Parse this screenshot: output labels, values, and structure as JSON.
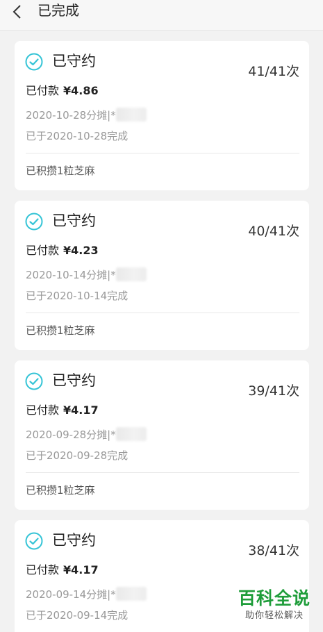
{
  "header": {
    "title": "已完成",
    "back_icon": "chevron-left-icon"
  },
  "colors": {
    "check_accent": "#35c4d6",
    "background": "#f2f2f2"
  },
  "records": [
    {
      "status": "已守约",
      "count": "41/41次",
      "paid_label": "已付款",
      "amount": "¥4.86",
      "installment": "2020-10-28分摊|*",
      "completed": "已于2020-10-28完成",
      "sesame": "已积攒1粒芝麻"
    },
    {
      "status": "已守约",
      "count": "40/41次",
      "paid_label": "已付款",
      "amount": "¥4.23",
      "installment": "2020-10-14分摊|*",
      "completed": "已于2020-10-14完成",
      "sesame": "已积攒1粒芝麻"
    },
    {
      "status": "已守约",
      "count": "39/41次",
      "paid_label": "已付款",
      "amount": "¥4.17",
      "installment": "2020-09-28分摊|*",
      "completed": "已于2020-09-28完成",
      "sesame": "已积攒1粒芝麻"
    },
    {
      "status": "已守约",
      "count": "38/41次",
      "paid_label": "已付款",
      "amount": "¥4.17",
      "installment": "2020-09-14分摊|*",
      "completed": "已于2020-09-14完成",
      "sesame": ""
    }
  ],
  "watermark": {
    "main": "百科全说",
    "sub": "助你轻松解决"
  }
}
